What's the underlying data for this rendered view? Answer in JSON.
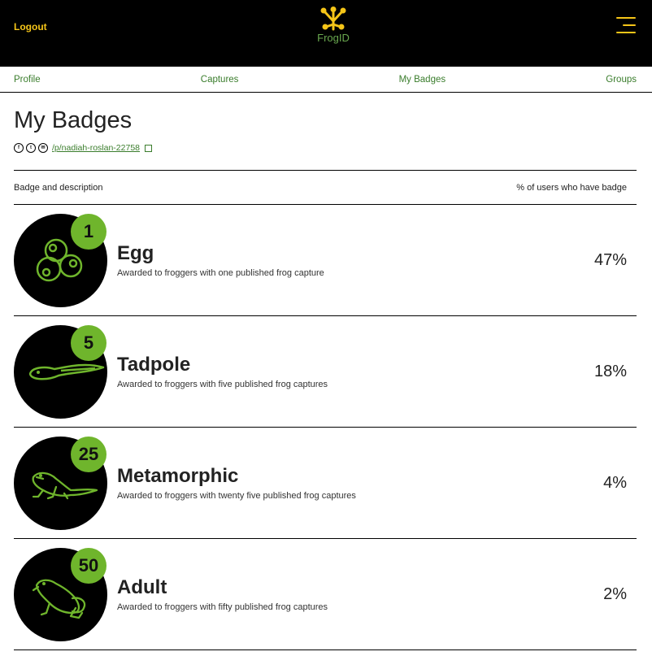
{
  "header": {
    "logout_label": "Logout",
    "logo_text": "FrogID",
    "accent_color": "#f5c518",
    "brand_green": "#6aa84f"
  },
  "nav": {
    "items": [
      {
        "label": "Profile"
      },
      {
        "label": "Captures"
      },
      {
        "label": "My Badges"
      },
      {
        "label": "Groups"
      }
    ]
  },
  "page": {
    "title": "My Badges",
    "share_link": "/p/nadiah-roslan-22758",
    "share_icons": [
      "facebook-icon",
      "twitter-icon",
      "email-icon",
      "copy-icon"
    ]
  },
  "table": {
    "col_badge": "Badge and description",
    "col_pct": "% of users who have badge"
  },
  "badges": [
    {
      "count": "1",
      "name": "Egg",
      "description": "Awarded to froggers with one published frog capture",
      "percent": "47%",
      "icon": "eggs-icon"
    },
    {
      "count": "5",
      "name": "Tadpole",
      "description": "Awarded to froggers with five published frog captures",
      "percent": "18%",
      "icon": "tadpole-icon"
    },
    {
      "count": "25",
      "name": "Metamorphic",
      "description": "Awarded to froggers with twenty five published frog captures",
      "percent": "4%",
      "icon": "metamorph-icon"
    },
    {
      "count": "50",
      "name": "Adult",
      "description": "Awarded to froggers with fifty published frog captures",
      "percent": "2%",
      "icon": "frog-icon"
    }
  ]
}
